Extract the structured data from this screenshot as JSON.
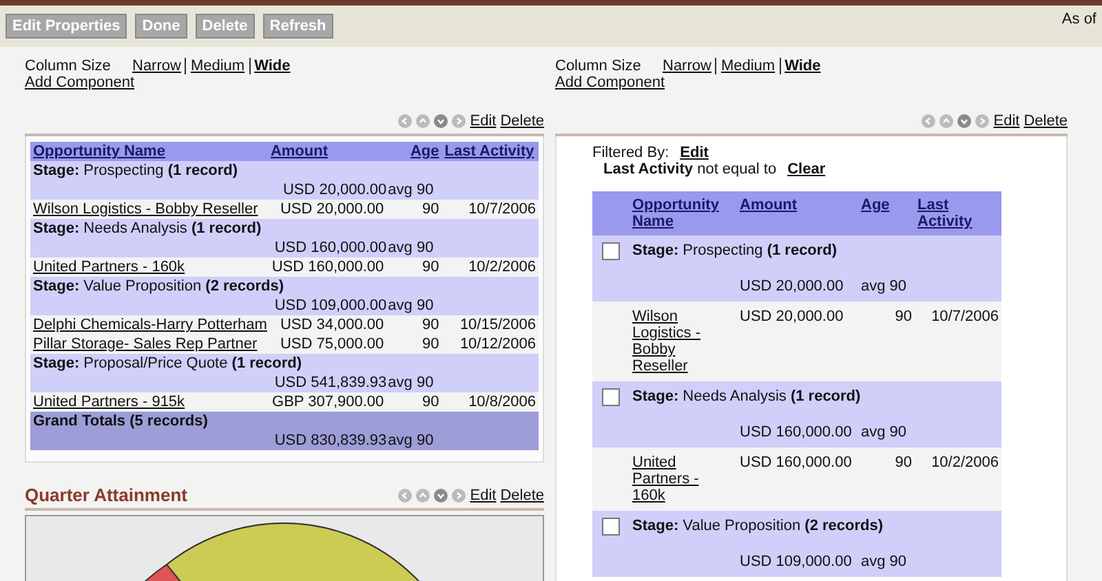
{
  "toolbar": {
    "buttons": [
      "Edit Properties",
      "Done",
      "Delete",
      "Refresh"
    ],
    "as_of": "As of"
  },
  "left_column": {
    "column_size": {
      "label": "Column Size",
      "options": [
        {
          "label": "Narrow",
          "selected": false
        },
        {
          "label": "Medium",
          "selected": false
        },
        {
          "label": "Wide",
          "selected": true
        }
      ]
    },
    "add_component": "Add Component",
    "report": {
      "actions": [
        "Edit",
        "Delete"
      ],
      "table": {
        "columns": [
          "Opportunity Name",
          "Amount",
          "Age",
          "Last Activity"
        ],
        "rows": [
          {
            "kind": "group",
            "stage": "**Stage:** Prospecting **(1 record)**",
            "amount": "USD 20,000.00",
            "age": "avg 90"
          },
          {
            "kind": "record",
            "name": "Wilson Logistics - Bobby Reseller",
            "amount": "USD 20,000.00",
            "age": "90",
            "last_activity": "10/7/2006"
          },
          {
            "kind": "group",
            "stage": "**Stage:** Needs Analysis **(1 record)**",
            "amount": "USD 160,000.00",
            "age": "avg 90"
          },
          {
            "kind": "record",
            "name": "United Partners - 160k",
            "amount": "USD 160,000.00",
            "age": "90",
            "last_activity": "10/2/2006"
          },
          {
            "kind": "group",
            "stage": "**Stage:** Value Proposition **(2 records)**",
            "amount": "USD 109,000.00",
            "age": "avg 90"
          },
          {
            "kind": "record",
            "name": "Delphi Chemicals-Harry Potterham",
            "amount": "USD 34,000.00",
            "age": "90",
            "last_activity": "10/15/2006"
          },
          {
            "kind": "record",
            "name": "Pillar Storage- Sales Rep Partner",
            "amount": "USD 75,000.00",
            "age": "90",
            "last_activity": "10/12/2006"
          },
          {
            "kind": "group",
            "stage": "**Stage:** Proposal/Price Quote **(1 record)**",
            "amount": "USD 541,839.93",
            "age": "avg 90"
          },
          {
            "kind": "record",
            "name": "United Partners - 915k",
            "amount": "GBP 307,900.00",
            "age": "90",
            "last_activity": "10/8/2006"
          },
          {
            "kind": "total",
            "stage": "Grand Totals (5 records)",
            "amount": "USD 830,839.93",
            "age": "avg 90"
          }
        ]
      }
    },
    "chart": {
      "title": "Quarter Attainment",
      "actions": [
        "Edit",
        "Delete"
      ]
    }
  },
  "right_column": {
    "column_size": {
      "label": "Column Size",
      "options": [
        {
          "label": "Narrow",
          "selected": false
        },
        {
          "label": "Medium",
          "selected": false
        },
        {
          "label": "Wide",
          "selected": true
        }
      ]
    },
    "add_component": "Add Component",
    "report": {
      "actions": [
        "Edit",
        "Delete"
      ],
      "filter": {
        "label": "Filtered By:",
        "edit": "Edit",
        "field": "Last Activity",
        "operator": "not equal to",
        "clear": "Clear"
      },
      "table": {
        "columns": [
          "Opportunity Name",
          "Amount",
          "Age",
          "Last Activity"
        ],
        "rows": [
          {
            "kind": "group",
            "checked": false,
            "stage": "**Stage:** Prospecting **(1 record)**",
            "amount": "USD 20,000.00",
            "age": "avg 90"
          },
          {
            "kind": "record",
            "name": "Wilson Logistics - Bobby Reseller",
            "amount": "USD 20,000.00",
            "age": "90",
            "last_activity": "10/7/2006"
          },
          {
            "kind": "group",
            "checked": false,
            "stage": "**Stage:** Needs Analysis **(1 record)**",
            "amount": "USD 160,000.00",
            "age": "avg 90"
          },
          {
            "kind": "record",
            "name": "United Partners - 160k",
            "amount": "USD 160,000.00",
            "age": "90",
            "last_activity": "10/2/2006"
          },
          {
            "kind": "group",
            "checked": false,
            "stage": "**Stage:** Value Proposition **(2 records)**",
            "amount": "USD 109,000.00",
            "age": "avg 90"
          }
        ]
      }
    }
  }
}
